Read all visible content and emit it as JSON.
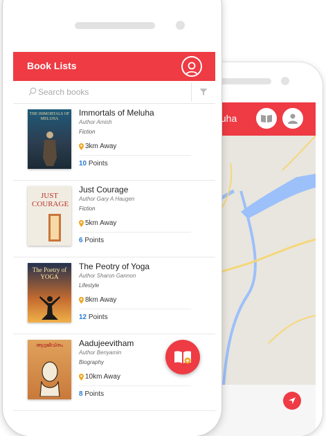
{
  "back_phone": {
    "header_title": "eluha",
    "route_color": "#1a1ae0",
    "map_colors": {
      "land": "#e9e6df",
      "water": "#9cc0f9",
      "road": "#f5d77a"
    }
  },
  "app": {
    "title": "Book Lists",
    "accent": "#ee3b44",
    "points_color": "#2b7bd3",
    "search": {
      "placeholder": "Search books"
    }
  },
  "books": [
    {
      "title": "Immortals of Meluha",
      "author": "Author Amish",
      "genre": "Fiction",
      "distance": "3km Away",
      "points": "10",
      "points_label": "Points",
      "cover_text": "THE IMMORTALS OF MELUHA"
    },
    {
      "title": "Just Courage",
      "author": "Author Gary A Haugen",
      "genre": "Fiction",
      "distance": "5km Away",
      "points": "6",
      "points_label": "Points",
      "cover_text": "JUST COURAGE"
    },
    {
      "title": "The Peotry of Yoga",
      "author": "Author Sharon Gannon",
      "genre": "Lifestyle",
      "distance": "8km Away",
      "points": "12",
      "points_label": "Points",
      "cover_text": "The Poetry of YOGA"
    },
    {
      "title": "Aadujeevitham",
      "author": "Author Benyamin",
      "genre": "Biography",
      "distance": "10km Away",
      "points": "8",
      "points_label": "Points",
      "cover_text": "ആടുജീവിതം"
    }
  ],
  "icons": {
    "profile": "user-circle-icon",
    "search": "search-icon",
    "filter": "filter-icon",
    "location": "location-pin-icon",
    "read": "open-book-icon",
    "navigate": "navigation-arrow-icon"
  }
}
